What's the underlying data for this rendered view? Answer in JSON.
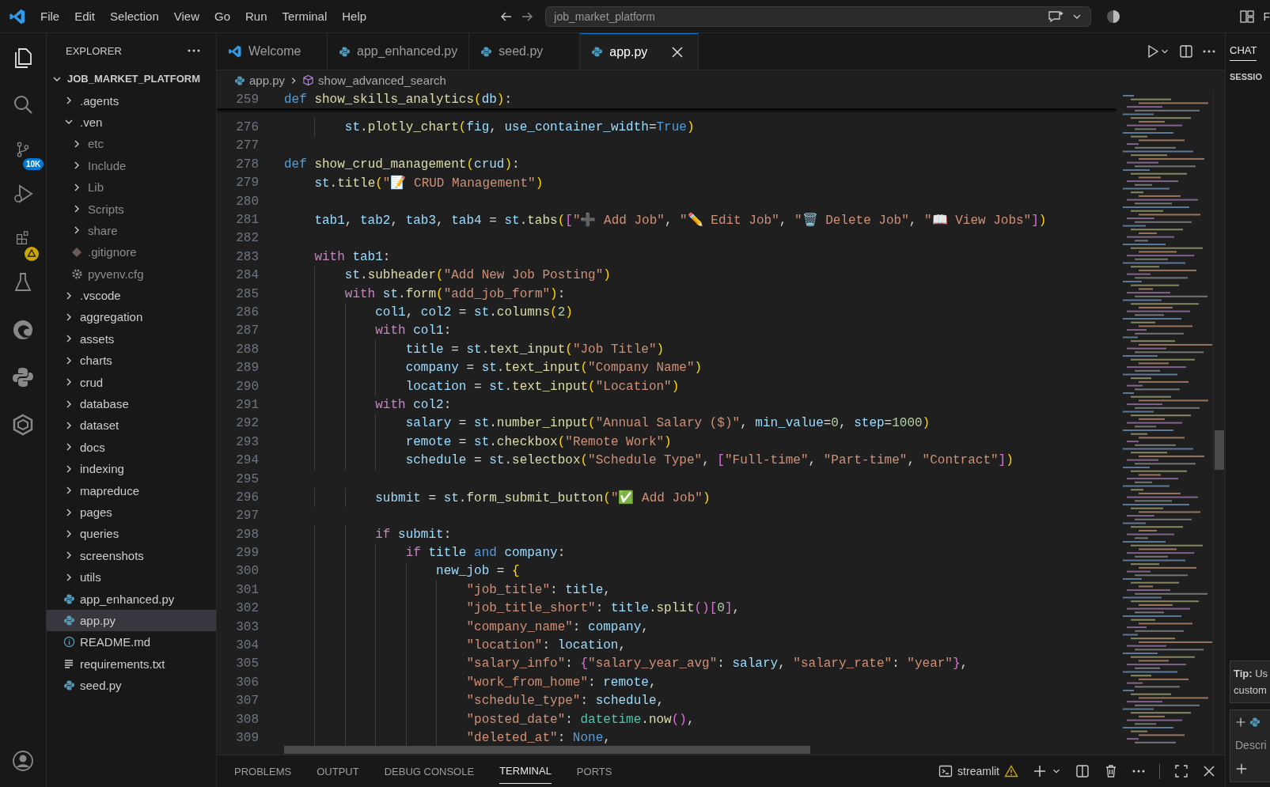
{
  "menu": [
    "File",
    "Edit",
    "Selection",
    "View",
    "Go",
    "Run",
    "Terminal",
    "Help"
  ],
  "search": {
    "value": "job_market_platform"
  },
  "top_right_text": "F",
  "activity_bar": {
    "badge": "10K"
  },
  "explorer": {
    "title": "EXPLORER",
    "root": {
      "label": "JOB_MARKET_PLATFORM",
      "expanded": true
    },
    "items": [
      {
        "label": ".agents",
        "kind": "folder",
        "expanded": false,
        "selected": false
      },
      {
        "label": ".ven",
        "kind": "folder",
        "expanded": true,
        "selected": false,
        "children": [
          {
            "label": "etc",
            "kind": "folder",
            "expanded": false,
            "selected": false,
            "dim": true
          },
          {
            "label": "Include",
            "kind": "folder",
            "expanded": false,
            "selected": false,
            "dim": true
          },
          {
            "label": "Lib",
            "kind": "folder",
            "expanded": false,
            "selected": false,
            "dim": true
          },
          {
            "label": "Scripts",
            "kind": "folder",
            "expanded": false,
            "selected": false,
            "dim": true
          },
          {
            "label": "share",
            "kind": "folder",
            "expanded": false,
            "selected": false,
            "dim": true
          },
          {
            "label": ".gitignore",
            "kind": "git",
            "selected": false,
            "dim": true
          },
          {
            "label": "pyvenv.cfg",
            "kind": "config",
            "selected": false,
            "dim": true
          }
        ]
      },
      {
        "label": ".vscode",
        "kind": "folder",
        "expanded": false,
        "selected": false
      },
      {
        "label": "aggregation",
        "kind": "folder",
        "expanded": false,
        "selected": false
      },
      {
        "label": "assets",
        "kind": "folder",
        "expanded": false,
        "selected": false
      },
      {
        "label": "charts",
        "kind": "folder",
        "expanded": false,
        "selected": false
      },
      {
        "label": "crud",
        "kind": "folder",
        "expanded": false,
        "selected": false
      },
      {
        "label": "database",
        "kind": "folder",
        "expanded": false,
        "selected": false
      },
      {
        "label": "dataset",
        "kind": "folder",
        "expanded": false,
        "selected": false
      },
      {
        "label": "docs",
        "kind": "folder",
        "expanded": false,
        "selected": false
      },
      {
        "label": "indexing",
        "kind": "folder",
        "expanded": false,
        "selected": false
      },
      {
        "label": "mapreduce",
        "kind": "folder",
        "expanded": false,
        "selected": false
      },
      {
        "label": "pages",
        "kind": "folder",
        "expanded": false,
        "selected": false
      },
      {
        "label": "queries",
        "kind": "folder",
        "expanded": false,
        "selected": false
      },
      {
        "label": "screenshots",
        "kind": "folder",
        "expanded": false,
        "selected": false
      },
      {
        "label": "utils",
        "kind": "folder",
        "expanded": false,
        "selected": false
      },
      {
        "label": "app_enhanced.py",
        "kind": "python",
        "selected": false
      },
      {
        "label": "app.py",
        "kind": "python",
        "selected": true
      },
      {
        "label": "README.md",
        "kind": "info",
        "selected": false
      },
      {
        "label": "requirements.txt",
        "kind": "text",
        "selected": false
      },
      {
        "label": "seed.py",
        "kind": "python",
        "selected": false
      }
    ]
  },
  "tabs": [
    {
      "label": "Welcome",
      "kind": "vscode",
      "selected": false
    },
    {
      "label": "app_enhanced.py",
      "kind": "python",
      "selected": false
    },
    {
      "label": "seed.py",
      "kind": "python",
      "selected": false
    },
    {
      "label": "app.py",
      "kind": "python",
      "selected": true
    }
  ],
  "breadcrumb": [
    "app.py",
    "show_advanced_search"
  ],
  "editor": {
    "sticky": {
      "n": "259",
      "tokens": [
        {
          "text": "def",
          "kind": "k"
        },
        {
          "text": " show_skills_analytics",
          "kind": "f"
        },
        {
          "text": "(",
          "kind": "b1"
        },
        {
          "text": "db",
          "kind": "v"
        },
        {
          "text": ")",
          "kind": "b1"
        },
        {
          "text": ":",
          "kind": "p"
        }
      ]
    },
    "lines": [
      {
        "n": "276",
        "tokens": [
          {
            "text": "        st",
            "kind": "v"
          },
          {
            "text": ".",
            "kind": "p"
          },
          {
            "text": "plotly_chart",
            "kind": "f"
          },
          {
            "text": "(",
            "kind": "b1"
          },
          {
            "text": "fig",
            "kind": "v"
          },
          {
            "text": ", ",
            "kind": "p"
          },
          {
            "text": "use_container_width",
            "kind": "v"
          },
          {
            "text": "=",
            "kind": "p"
          },
          {
            "text": "True",
            "kind": "k"
          },
          {
            "text": ")",
            "kind": "b1"
          }
        ]
      },
      {
        "n": "277"
      },
      {
        "n": "278",
        "tokens": [
          {
            "text": "def",
            "kind": "k"
          },
          {
            "text": " show_crud_management",
            "kind": "f"
          },
          {
            "text": "(",
            "kind": "b1"
          },
          {
            "text": "crud",
            "kind": "v"
          },
          {
            "text": ")",
            "kind": "b1"
          },
          {
            "text": ":",
            "kind": "p"
          }
        ]
      },
      {
        "n": "279",
        "tokens": [
          {
            "text": "    st",
            "kind": "v"
          },
          {
            "text": ".",
            "kind": "p"
          },
          {
            "text": "title",
            "kind": "f"
          },
          {
            "text": "(",
            "kind": "b1"
          },
          {
            "text": "\"📝 CRUD Management\"",
            "kind": "s"
          },
          {
            "text": ")",
            "kind": "b1"
          }
        ]
      },
      {
        "n": "280"
      },
      {
        "n": "281",
        "tokens": [
          {
            "text": "    tab1",
            "kind": "v"
          },
          {
            "text": ", ",
            "kind": "p"
          },
          {
            "text": "tab2",
            "kind": "v"
          },
          {
            "text": ", ",
            "kind": "p"
          },
          {
            "text": "tab3",
            "kind": "v"
          },
          {
            "text": ", ",
            "kind": "p"
          },
          {
            "text": "tab4",
            "kind": "v"
          },
          {
            "text": " = ",
            "kind": "p"
          },
          {
            "text": "st",
            "kind": "v"
          },
          {
            "text": ".",
            "kind": "p"
          },
          {
            "text": "tabs",
            "kind": "f"
          },
          {
            "text": "(",
            "kind": "b1"
          },
          {
            "text": "[",
            "kind": "b2"
          },
          {
            "text": "\"➕ Add Job\"",
            "kind": "s"
          },
          {
            "text": ", ",
            "kind": "p"
          },
          {
            "text": "\"✏️ Edit Job\"",
            "kind": "s"
          },
          {
            "text": ", ",
            "kind": "p"
          },
          {
            "text": "\"🗑️ Delete Job\"",
            "kind": "s"
          },
          {
            "text": ", ",
            "kind": "p"
          },
          {
            "text": "\"📖 View Jobs\"",
            "kind": "s"
          },
          {
            "text": "]",
            "kind": "b2"
          },
          {
            "text": ")",
            "kind": "b1"
          }
        ]
      },
      {
        "n": "282"
      },
      {
        "n": "283",
        "tokens": [
          {
            "text": "    with",
            "kind": "c"
          },
          {
            "text": " tab1",
            "kind": "v"
          },
          {
            "text": ":",
            "kind": "p"
          }
        ]
      },
      {
        "n": "284",
        "tokens": [
          {
            "text": "        st",
            "kind": "v"
          },
          {
            "text": ".",
            "kind": "p"
          },
          {
            "text": "subheader",
            "kind": "f"
          },
          {
            "text": "(",
            "kind": "b1"
          },
          {
            "text": "\"Add New Job Posting\"",
            "kind": "s"
          },
          {
            "text": ")",
            "kind": "b1"
          }
        ]
      },
      {
        "n": "285",
        "tokens": [
          {
            "text": "        with",
            "kind": "c"
          },
          {
            "text": " st",
            "kind": "v"
          },
          {
            "text": ".",
            "kind": "p"
          },
          {
            "text": "form",
            "kind": "f"
          },
          {
            "text": "(",
            "kind": "b1"
          },
          {
            "text": "\"add_job_form\"",
            "kind": "s"
          },
          {
            "text": ")",
            "kind": "b1"
          },
          {
            "text": ":",
            "kind": "p"
          }
        ]
      },
      {
        "n": "286",
        "tokens": [
          {
            "text": "            col1",
            "kind": "v"
          },
          {
            "text": ", ",
            "kind": "p"
          },
          {
            "text": "col2",
            "kind": "v"
          },
          {
            "text": " = ",
            "kind": "p"
          },
          {
            "text": "st",
            "kind": "v"
          },
          {
            "text": ".",
            "kind": "p"
          },
          {
            "text": "columns",
            "kind": "f"
          },
          {
            "text": "(",
            "kind": "b1"
          },
          {
            "text": "2",
            "kind": "n"
          },
          {
            "text": ")",
            "kind": "b1"
          }
        ]
      },
      {
        "n": "287",
        "tokens": [
          {
            "text": "            with",
            "kind": "c"
          },
          {
            "text": " col1",
            "kind": "v"
          },
          {
            "text": ":",
            "kind": "p"
          }
        ]
      },
      {
        "n": "288",
        "tokens": [
          {
            "text": "                title",
            "kind": "v"
          },
          {
            "text": " = ",
            "kind": "p"
          },
          {
            "text": "st",
            "kind": "v"
          },
          {
            "text": ".",
            "kind": "p"
          },
          {
            "text": "text_input",
            "kind": "f"
          },
          {
            "text": "(",
            "kind": "b1"
          },
          {
            "text": "\"Job Title\"",
            "kind": "s"
          },
          {
            "text": ")",
            "kind": "b1"
          }
        ]
      },
      {
        "n": "289",
        "tokens": [
          {
            "text": "                company",
            "kind": "v"
          },
          {
            "text": " = ",
            "kind": "p"
          },
          {
            "text": "st",
            "kind": "v"
          },
          {
            "text": ".",
            "kind": "p"
          },
          {
            "text": "text_input",
            "kind": "f"
          },
          {
            "text": "(",
            "kind": "b1"
          },
          {
            "text": "\"Company Name\"",
            "kind": "s"
          },
          {
            "text": ")",
            "kind": "b1"
          }
        ]
      },
      {
        "n": "290",
        "tokens": [
          {
            "text": "                location",
            "kind": "v"
          },
          {
            "text": " = ",
            "kind": "p"
          },
          {
            "text": "st",
            "kind": "v"
          },
          {
            "text": ".",
            "kind": "p"
          },
          {
            "text": "text_input",
            "kind": "f"
          },
          {
            "text": "(",
            "kind": "b1"
          },
          {
            "text": "\"Location\"",
            "kind": "s"
          },
          {
            "text": ")",
            "kind": "b1"
          }
        ]
      },
      {
        "n": "291",
        "tokens": [
          {
            "text": "            with",
            "kind": "c"
          },
          {
            "text": " col2",
            "kind": "v"
          },
          {
            "text": ":",
            "kind": "p"
          }
        ]
      },
      {
        "n": "292",
        "tokens": [
          {
            "text": "                salary",
            "kind": "v"
          },
          {
            "text": " = ",
            "kind": "p"
          },
          {
            "text": "st",
            "kind": "v"
          },
          {
            "text": ".",
            "kind": "p"
          },
          {
            "text": "number_input",
            "kind": "f"
          },
          {
            "text": "(",
            "kind": "b1"
          },
          {
            "text": "\"Annual Salary ($)\"",
            "kind": "s"
          },
          {
            "text": ", ",
            "kind": "p"
          },
          {
            "text": "min_value",
            "kind": "v"
          },
          {
            "text": "=",
            "kind": "p"
          },
          {
            "text": "0",
            "kind": "n"
          },
          {
            "text": ", ",
            "kind": "p"
          },
          {
            "text": "step",
            "kind": "v"
          },
          {
            "text": "=",
            "kind": "p"
          },
          {
            "text": "1000",
            "kind": "n"
          },
          {
            "text": ")",
            "kind": "b1"
          }
        ]
      },
      {
        "n": "293",
        "tokens": [
          {
            "text": "                remote",
            "kind": "v"
          },
          {
            "text": " = ",
            "kind": "p"
          },
          {
            "text": "st",
            "kind": "v"
          },
          {
            "text": ".",
            "kind": "p"
          },
          {
            "text": "checkbox",
            "kind": "f"
          },
          {
            "text": "(",
            "kind": "b1"
          },
          {
            "text": "\"Remote Work\"",
            "kind": "s"
          },
          {
            "text": ")",
            "kind": "b1"
          }
        ]
      },
      {
        "n": "294",
        "tokens": [
          {
            "text": "                schedule",
            "kind": "v"
          },
          {
            "text": " = ",
            "kind": "p"
          },
          {
            "text": "st",
            "kind": "v"
          },
          {
            "text": ".",
            "kind": "p"
          },
          {
            "text": "selectbox",
            "kind": "f"
          },
          {
            "text": "(",
            "kind": "b1"
          },
          {
            "text": "\"Schedule Type\"",
            "kind": "s"
          },
          {
            "text": ", ",
            "kind": "p"
          },
          {
            "text": "[",
            "kind": "b2"
          },
          {
            "text": "\"Full-time\"",
            "kind": "s"
          },
          {
            "text": ", ",
            "kind": "p"
          },
          {
            "text": "\"Part-time\"",
            "kind": "s"
          },
          {
            "text": ", ",
            "kind": "p"
          },
          {
            "text": "\"Contract\"",
            "kind": "s"
          },
          {
            "text": "]",
            "kind": "b2"
          },
          {
            "text": ")",
            "kind": "b1"
          }
        ]
      },
      {
        "n": "295"
      },
      {
        "n": "296",
        "tokens": [
          {
            "text": "            submit",
            "kind": "v"
          },
          {
            "text": " = ",
            "kind": "p"
          },
          {
            "text": "st",
            "kind": "v"
          },
          {
            "text": ".",
            "kind": "p"
          },
          {
            "text": "form_submit_button",
            "kind": "f"
          },
          {
            "text": "(",
            "kind": "b1"
          },
          {
            "text": "\"✅ Add Job\"",
            "kind": "s"
          },
          {
            "text": ")",
            "kind": "b1"
          }
        ]
      },
      {
        "n": "297"
      },
      {
        "n": "298",
        "tokens": [
          {
            "text": "            if",
            "kind": "c"
          },
          {
            "text": " submit",
            "kind": "v"
          },
          {
            "text": ":",
            "kind": "p"
          }
        ]
      },
      {
        "n": "299",
        "tokens": [
          {
            "text": "                if",
            "kind": "c"
          },
          {
            "text": " title",
            "kind": "v"
          },
          {
            "text": " and",
            "kind": "k"
          },
          {
            "text": " company",
            "kind": "v"
          },
          {
            "text": ":",
            "kind": "p"
          }
        ]
      },
      {
        "n": "300",
        "tokens": [
          {
            "text": "                    new_job",
            "kind": "v"
          },
          {
            "text": " = ",
            "kind": "p"
          },
          {
            "text": "{",
            "kind": "b1"
          }
        ]
      },
      {
        "n": "301",
        "tokens": [
          {
            "text": "                        \"job_title\"",
            "kind": "s"
          },
          {
            "text": ": ",
            "kind": "p"
          },
          {
            "text": "title",
            "kind": "v"
          },
          {
            "text": ",",
            "kind": "p"
          }
        ]
      },
      {
        "n": "302",
        "tokens": [
          {
            "text": "                        \"job_title_short\"",
            "kind": "s"
          },
          {
            "text": ": ",
            "kind": "p"
          },
          {
            "text": "title",
            "kind": "v"
          },
          {
            "text": ".",
            "kind": "p"
          },
          {
            "text": "split",
            "kind": "f"
          },
          {
            "text": "()",
            "kind": "b2"
          },
          {
            "text": "[",
            "kind": "b2"
          },
          {
            "text": "0",
            "kind": "n"
          },
          {
            "text": "]",
            "kind": "b2"
          },
          {
            "text": ",",
            "kind": "p"
          }
        ]
      },
      {
        "n": "303",
        "tokens": [
          {
            "text": "                        \"company_name\"",
            "kind": "s"
          },
          {
            "text": ": ",
            "kind": "p"
          },
          {
            "text": "company",
            "kind": "v"
          },
          {
            "text": ",",
            "kind": "p"
          }
        ]
      },
      {
        "n": "304",
        "tokens": [
          {
            "text": "                        \"location\"",
            "kind": "s"
          },
          {
            "text": ": ",
            "kind": "p"
          },
          {
            "text": "location",
            "kind": "v"
          },
          {
            "text": ",",
            "kind": "p"
          }
        ]
      },
      {
        "n": "305",
        "tokens": [
          {
            "text": "                        \"salary_info\"",
            "kind": "s"
          },
          {
            "text": ": ",
            "kind": "p"
          },
          {
            "text": "{",
            "kind": "b2"
          },
          {
            "text": "\"salary_year_avg\"",
            "kind": "s"
          },
          {
            "text": ": ",
            "kind": "p"
          },
          {
            "text": "salary",
            "kind": "v"
          },
          {
            "text": ", ",
            "kind": "p"
          },
          {
            "text": "\"salary_rate\"",
            "kind": "s"
          },
          {
            "text": ": ",
            "kind": "p"
          },
          {
            "text": "\"year\"",
            "kind": "s"
          },
          {
            "text": "}",
            "kind": "b2"
          },
          {
            "text": ",",
            "kind": "p"
          }
        ]
      },
      {
        "n": "306",
        "tokens": [
          {
            "text": "                        \"work_from_home\"",
            "kind": "s"
          },
          {
            "text": ": ",
            "kind": "p"
          },
          {
            "text": "remote",
            "kind": "v"
          },
          {
            "text": ",",
            "kind": "p"
          }
        ]
      },
      {
        "n": "307",
        "tokens": [
          {
            "text": "                        \"schedule_type\"",
            "kind": "s"
          },
          {
            "text": ": ",
            "kind": "p"
          },
          {
            "text": "schedule",
            "kind": "v"
          },
          {
            "text": ",",
            "kind": "p"
          }
        ]
      },
      {
        "n": "308",
        "tokens": [
          {
            "text": "                        \"posted_date\"",
            "kind": "s"
          },
          {
            "text": ": ",
            "kind": "p"
          },
          {
            "text": "datetime",
            "kind": "cl"
          },
          {
            "text": ".",
            "kind": "p"
          },
          {
            "text": "now",
            "kind": "f"
          },
          {
            "text": "()",
            "kind": "b2"
          },
          {
            "text": ",",
            "kind": "p"
          }
        ]
      },
      {
        "n": "309",
        "tokens": [
          {
            "text": "                        \"deleted_at\"",
            "kind": "s"
          },
          {
            "text": ": ",
            "kind": "p"
          },
          {
            "text": "None",
            "kind": "k"
          },
          {
            "text": ",",
            "kind": "p"
          }
        ]
      }
    ]
  },
  "chat": {
    "tab": "CHAT",
    "section": "SESSIO",
    "tip": "**Tip:** Us",
    "tip_line2": "custom",
    "placeholder": "Descri"
  },
  "panel": {
    "tabs": [
      {
        "label": "PROBLEMS",
        "selected": false
      },
      {
        "label": "OUTPUT",
        "selected": false
      },
      {
        "label": "DEBUG CONSOLE",
        "selected": false
      },
      {
        "label": "TERMINAL",
        "selected": true
      },
      {
        "label": "PORTS",
        "selected": false
      }
    ],
    "terminal": "streamlit"
  }
}
